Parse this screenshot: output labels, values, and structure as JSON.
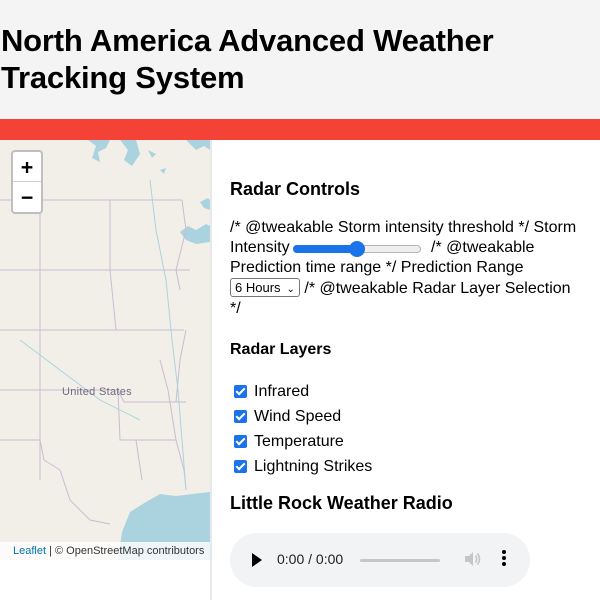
{
  "header": {
    "title": "North America Advanced Weather Tracking System"
  },
  "colors": {
    "header_bg": "#f4f4f4",
    "accent_bar": "#f44336",
    "control_accent": "#1a73e8",
    "map_land": "#f2efe9",
    "map_water": "#aad3df"
  },
  "map": {
    "zoom_in_label": "+",
    "zoom_out_label": "−",
    "country_label": "United States",
    "attribution_link": "Leaflet",
    "attribution_text": " | © OpenStreetMap contributors"
  },
  "radar_controls": {
    "heading": "Radar Controls",
    "comment_1": "/* @tweakable Storm intensity threshold */",
    "storm_label": "Storm Intensity",
    "storm_value_fraction": 0.5,
    "comment_2": "/* @tweakable Prediction time range */",
    "prediction_label": "Prediction Range",
    "prediction_selected": "6 Hours",
    "comment_3": "/* @tweakable Radar Layer Selection */"
  },
  "radar_layers": {
    "heading": "Radar Layers",
    "items": [
      {
        "label": "Infrared",
        "checked": true
      },
      {
        "label": "Wind Speed",
        "checked": true
      },
      {
        "label": "Temperature",
        "checked": true
      },
      {
        "label": "Lightning Strikes",
        "checked": true
      }
    ]
  },
  "radio": {
    "heading": "Little Rock Weather Radio",
    "time": "0:00 / 0:00",
    "volume_icon": "speaker-icon",
    "more_icon": "kebab-menu-icon"
  }
}
